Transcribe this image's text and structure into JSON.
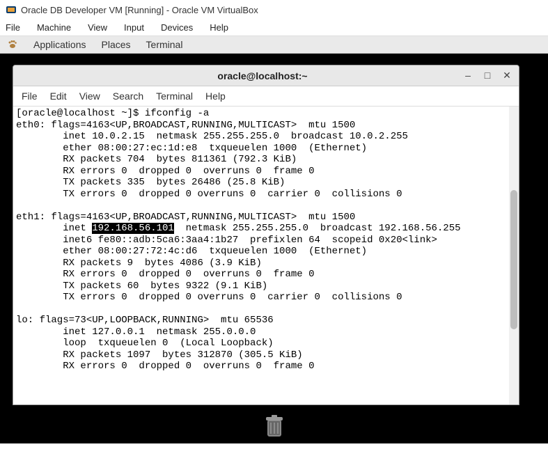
{
  "vbox": {
    "title": "Oracle DB Developer VM [Running] - Oracle VM VirtualBox",
    "menu": {
      "file": "File",
      "machine": "Machine",
      "view": "View",
      "input": "Input",
      "devices": "Devices",
      "help": "Help"
    }
  },
  "gnome": {
    "applications": "Applications",
    "places": "Places",
    "terminal": "Terminal"
  },
  "termwin": {
    "title": "oracle@localhost:~",
    "menu": {
      "file": "File",
      "edit": "Edit",
      "view": "View",
      "search": "Search",
      "terminal": "Terminal",
      "help": "Help"
    }
  },
  "shell": {
    "prompt": "[oracle@localhost ~]$ ",
    "cmd": "ifconfig -a",
    "eth0": {
      "hdr": "eth0: flags=4163<UP,BROADCAST,RUNNING,MULTICAST>  mtu 1500",
      "l1": "        inet 10.0.2.15  netmask 255.255.255.0  broadcast 10.0.2.255",
      "l2": "        ether 08:00:27:ec:1d:e8  txqueuelen 1000  (Ethernet)",
      "l3": "        RX packets 704  bytes 811361 (792.3 KiB)",
      "l4": "        RX errors 0  dropped 0  overruns 0  frame 0",
      "l5": "        TX packets 335  bytes 26486 (25.8 KiB)",
      "l6": "        TX errors 0  dropped 0 overruns 0  carrier 0  collisions 0"
    },
    "eth1": {
      "hdr": "eth1: flags=4163<UP,BROADCAST,RUNNING,MULTICAST>  mtu 1500",
      "l1a": "        inet ",
      "l1hl": "192.168.56.101",
      "l1b": "  netmask 255.255.255.0  broadcast 192.168.56.255",
      "l2": "        inet6 fe80::adb:5ca6:3aa4:1b27  prefixlen 64  scopeid 0x20<link>",
      "l3": "        ether 08:00:27:72:4c:d6  txqueuelen 1000  (Ethernet)",
      "l4": "        RX packets 9  bytes 4086 (3.9 KiB)",
      "l5": "        RX errors 0  dropped 0  overruns 0  frame 0",
      "l6": "        TX packets 60  bytes 9322 (9.1 KiB)",
      "l7": "        TX errors 0  dropped 0 overruns 0  carrier 0  collisions 0"
    },
    "lo": {
      "hdr": "lo: flags=73<UP,LOOPBACK,RUNNING>  mtu 65536",
      "l1": "        inet 127.0.0.1  netmask 255.0.0.0",
      "l2": "        loop  txqueuelen 0  (Local Loopback)",
      "l3": "        RX packets 1097  bytes 312870 (305.5 KiB)",
      "l4": "        RX errors 0  dropped 0  overruns 0  frame 0"
    }
  }
}
